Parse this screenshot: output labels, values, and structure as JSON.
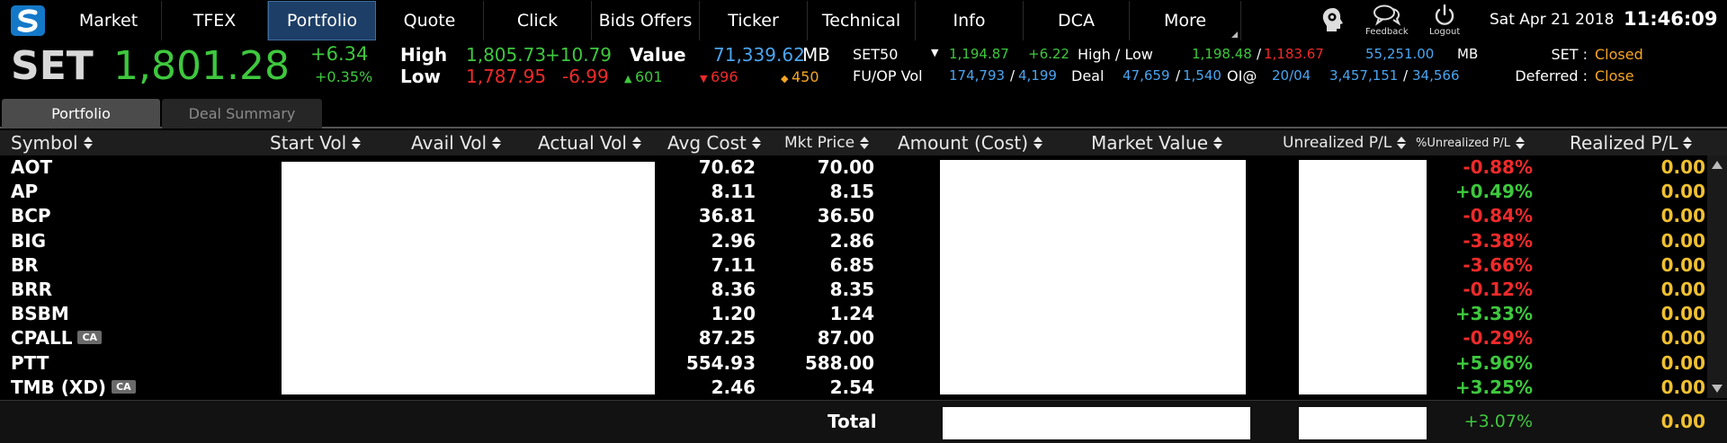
{
  "nav": {
    "tabs": [
      {
        "label": "Market",
        "active": false
      },
      {
        "label": "TFEX",
        "active": false
      },
      {
        "label": "Portfolio",
        "active": true
      },
      {
        "label": "Quote",
        "active": false
      },
      {
        "label": "Click",
        "active": false
      },
      {
        "label": "Bids Offers",
        "active": false
      },
      {
        "label": "Ticker",
        "active": false
      },
      {
        "label": "Technical",
        "active": false
      },
      {
        "label": "Info",
        "active": false
      },
      {
        "label": "DCA",
        "active": false
      },
      {
        "label": "More",
        "active": false
      }
    ],
    "feedback_label": "Feedback",
    "logout_label": "Logout",
    "date": "Sat Apr 21 2018",
    "time": "11:46:09"
  },
  "ticker": {
    "index_name": "SET",
    "index_value": "1,801.28",
    "change": "+6.34",
    "change_pct": "+0.35%",
    "high_label": "High",
    "high_value": "1,805.73",
    "high_change": "+10.79",
    "low_label": "Low",
    "low_value": "1,787.95",
    "low_change": "-6.99",
    "value_label": "Value",
    "value_amount": "71,339.62",
    "value_unit": "MB",
    "up_count": "601",
    "down_count": "696",
    "unchanged_count": "450",
    "set50_label": "SET50",
    "set50_value": "1,194.87",
    "set50_change": "+6.22",
    "set50_hl_label": "High / Low",
    "set50_high": "1,198.48",
    "set50_slash": "/",
    "set50_low": "1,183.67",
    "set50_value_amount": "55,251.00",
    "set50_value_unit": "MB",
    "fu_label": "FU/OP Vol",
    "fu_vol": "174,793",
    "fu_slash": "/",
    "op_vol": "4,199",
    "deal_label": "Deal",
    "deal_value": "47,659",
    "deal_slash": "/",
    "deal_value2": "1,540",
    "oi_label": "OI@",
    "oi_date": "20/04",
    "oi_value": "3,457,151",
    "oi_slash": "/",
    "oi_value2": "34,566",
    "set_status_label": "SET :",
    "set_status": "Closed",
    "deferred_label": "Deferred :",
    "deferred_status": "Close"
  },
  "subtabs": [
    {
      "label": "Portfolio",
      "active": true
    },
    {
      "label": "Deal Summary",
      "active": false
    }
  ],
  "table": {
    "columns": [
      {
        "key": "symbol",
        "label": "Symbol"
      },
      {
        "key": "start_vol",
        "label": "Start Vol"
      },
      {
        "key": "avail_vol",
        "label": "Avail Vol"
      },
      {
        "key": "actual_vol",
        "label": "Actual Vol"
      },
      {
        "key": "avg_cost",
        "label": "Avg Cost"
      },
      {
        "key": "mkt_price",
        "label": "Mkt Price"
      },
      {
        "key": "amount_cost",
        "label": "Amount (Cost)"
      },
      {
        "key": "market_value",
        "label": "Market Value"
      },
      {
        "key": "unrealized_pl",
        "label": "Unrealized P/L"
      },
      {
        "key": "pct_unrealized_pl",
        "label": "%Unrealized P/L"
      },
      {
        "key": "realized_pl",
        "label": "Realized P/L"
      }
    ],
    "rows": [
      {
        "symbol": "AOT",
        "badge": "",
        "avg_cost": "70.62",
        "mkt_price": "70.00",
        "pct": "-0.88%",
        "pct_dir": "down",
        "realized": "0.00"
      },
      {
        "symbol": "AP",
        "badge": "",
        "avg_cost": "8.11",
        "mkt_price": "8.15",
        "pct": "+0.49%",
        "pct_dir": "up",
        "realized": "0.00"
      },
      {
        "symbol": "BCP",
        "badge": "",
        "avg_cost": "36.81",
        "mkt_price": "36.50",
        "pct": "-0.84%",
        "pct_dir": "down",
        "realized": "0.00"
      },
      {
        "symbol": "BIG",
        "badge": "",
        "avg_cost": "2.96",
        "mkt_price": "2.86",
        "pct": "-3.38%",
        "pct_dir": "down",
        "realized": "0.00"
      },
      {
        "symbol": "BR",
        "badge": "",
        "avg_cost": "7.11",
        "mkt_price": "6.85",
        "pct": "-3.66%",
        "pct_dir": "down",
        "realized": "0.00"
      },
      {
        "symbol": "BRR",
        "badge": "",
        "avg_cost": "8.36",
        "mkt_price": "8.35",
        "pct": "-0.12%",
        "pct_dir": "down",
        "realized": "0.00"
      },
      {
        "symbol": "BSBM",
        "badge": "",
        "avg_cost": "1.20",
        "mkt_price": "1.24",
        "pct": "+3.33%",
        "pct_dir": "up",
        "realized": "0.00"
      },
      {
        "symbol": "CPALL",
        "badge": "CA",
        "avg_cost": "87.25",
        "mkt_price": "87.00",
        "pct": "-0.29%",
        "pct_dir": "down",
        "realized": "0.00"
      },
      {
        "symbol": "PTT",
        "badge": "",
        "avg_cost": "554.93",
        "mkt_price": "588.00",
        "pct": "+5.96%",
        "pct_dir": "up",
        "realized": "0.00"
      },
      {
        "symbol": "TMB (XD)",
        "badge": "CA",
        "avg_cost": "2.46",
        "mkt_price": "2.54",
        "pct": "+3.25%",
        "pct_dir": "up",
        "realized": "0.00"
      }
    ],
    "total": {
      "label": "Total",
      "pct": "+3.07%",
      "realized": "0.00"
    }
  },
  "colors": {
    "up": "#3ec83e",
    "down": "#f02a2a",
    "accent_blue": "#4aa5f0",
    "status_orange": "#f5a623",
    "realized_gold": "#f0c030",
    "active_tab": "#1d3e66"
  },
  "icons": {
    "logo": "streaming-logo-icon",
    "feedback": "head-gear-icon",
    "chat": "chat-bubbles-icon",
    "logout": "power-icon"
  }
}
